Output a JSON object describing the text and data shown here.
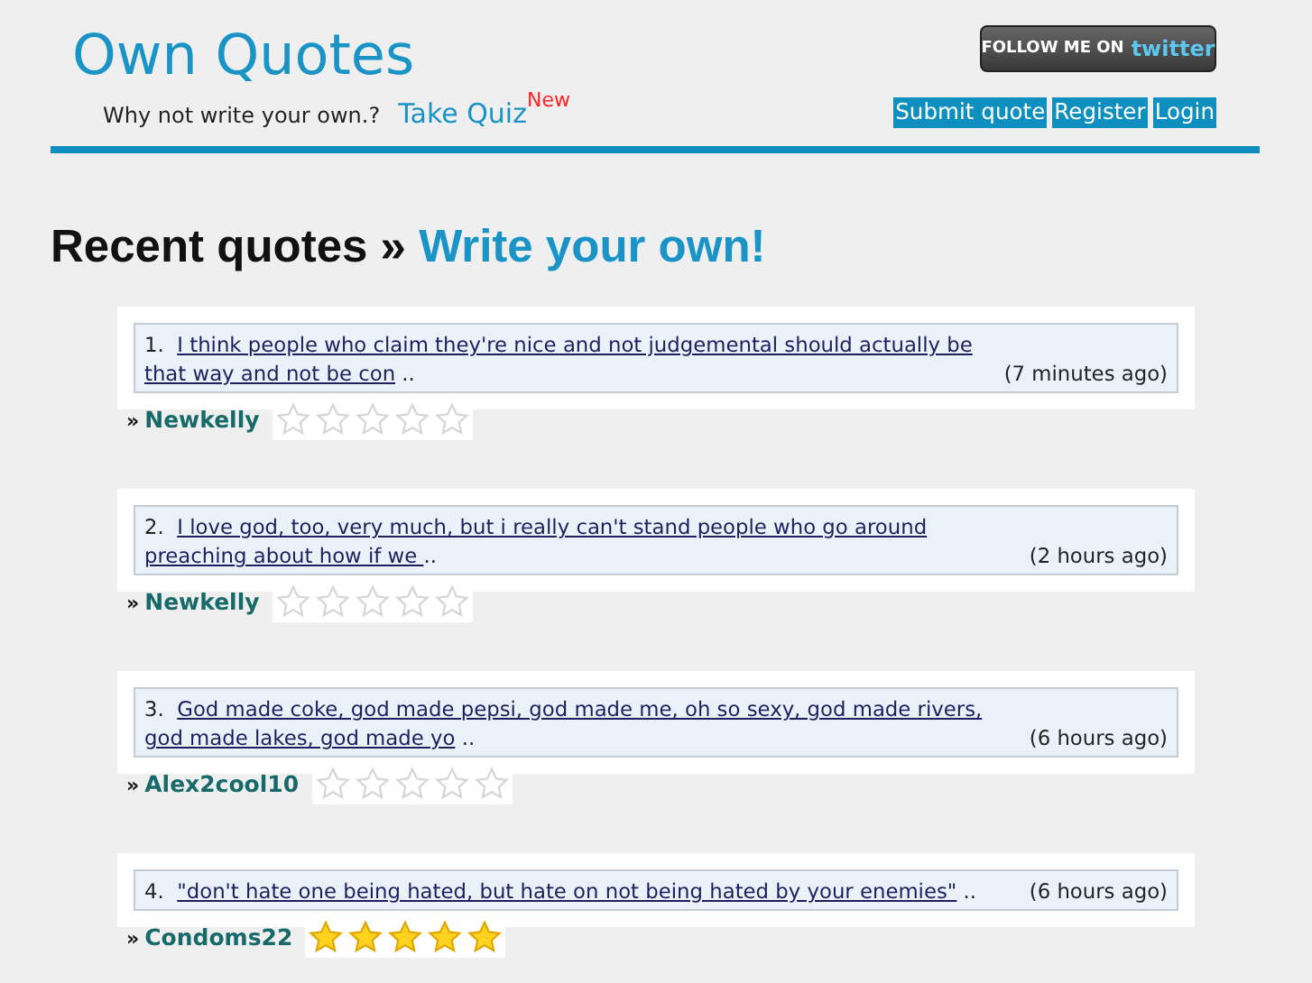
{
  "header": {
    "title": "Own Quotes",
    "tagline": "Why not write your own.?",
    "quiz_link": "Take Quiz",
    "quiz_badge": "New",
    "follow_button": {
      "prefix": "FOLLOW ME ON",
      "brand": "twitter"
    },
    "nav": [
      "Submit quote",
      "Register",
      "Login"
    ]
  },
  "heading": {
    "text": "Recent quotes »",
    "link": "Write your own!"
  },
  "quotes": [
    {
      "number": "1.",
      "text": "I think people who claim they're nice and not judgemental should actually be that way and not be con",
      "more": "..",
      "time": "(7 minutes ago)",
      "marker": "»",
      "author": "Newkelly",
      "stars": 0
    },
    {
      "number": "2.",
      "text": "I love god, too, very much, but i really can't stand people who go around preaching about how if we ",
      "more": "..",
      "time": "(2 hours ago)",
      "marker": "»",
      "author": "Newkelly",
      "stars": 0
    },
    {
      "number": "3.",
      "text": "God made coke, god made pepsi, god made me, oh so sexy, god made rivers, god made lakes, god made yo",
      "more": "..",
      "time": "(6 hours ago)",
      "marker": "»",
      "author": "Alex2cool10",
      "stars": 0
    },
    {
      "number": "4.",
      "text": "\"don't hate one being hated, but hate on not being hated by your enemies\"",
      "more": "..",
      "time": "(6 hours ago)",
      "marker": "»",
      "author": "Condoms22",
      "stars": 5
    }
  ]
}
